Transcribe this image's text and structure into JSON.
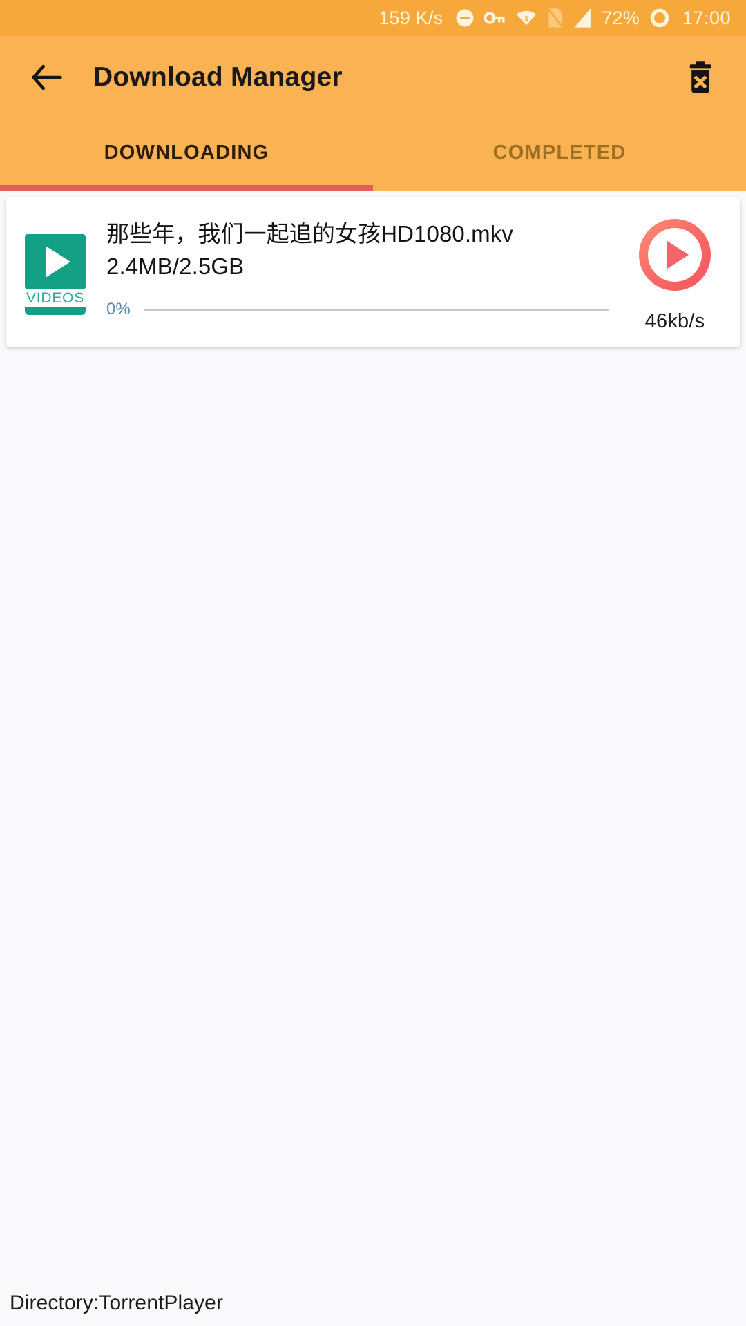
{
  "status_bar": {
    "network_speed": "159 K/s",
    "battery_percent": "72%",
    "clock": "17:00",
    "icons": [
      "do-not-disturb-icon",
      "vpn-key-icon",
      "wifi-icon",
      "sim-card-off-icon",
      "signal-bars-icon",
      "battery-ring-icon"
    ],
    "background_color": "#F7A83A",
    "text_color": "#FFF4E0"
  },
  "app_bar": {
    "back_label": "back-arrow",
    "title": "Download Manager",
    "delete_label": "delete-all",
    "background_color": "#FBB252",
    "title_color": "#191919"
  },
  "tabs": {
    "items": [
      {
        "label": "DOWNLOADING",
        "active": true
      },
      {
        "label": "COMPLETED",
        "active": false
      }
    ],
    "indicator_color": "#E35D5B",
    "active_color": "#2B1D06",
    "inactive_color": "#9C6F22"
  },
  "downloads": [
    {
      "thumbnail_label": "VIDEOS",
      "thumbnail_color": "#13A085",
      "file_name": "那些年，我们一起追的女孩HD1080.mkv",
      "size_text": "2.4MB/2.5GB",
      "downloaded": "2.4MB",
      "total": "2.5GB",
      "progress_percent": "0%",
      "progress_value": 0,
      "progress_color": "#5B8CB0",
      "speed": "46kb/s",
      "action": "play-resume",
      "action_color": "#F4646A"
    }
  ],
  "footer": {
    "directory_text": "Directory:TorrentPlayer"
  },
  "page": {
    "background_color": "#F9F8FB"
  }
}
